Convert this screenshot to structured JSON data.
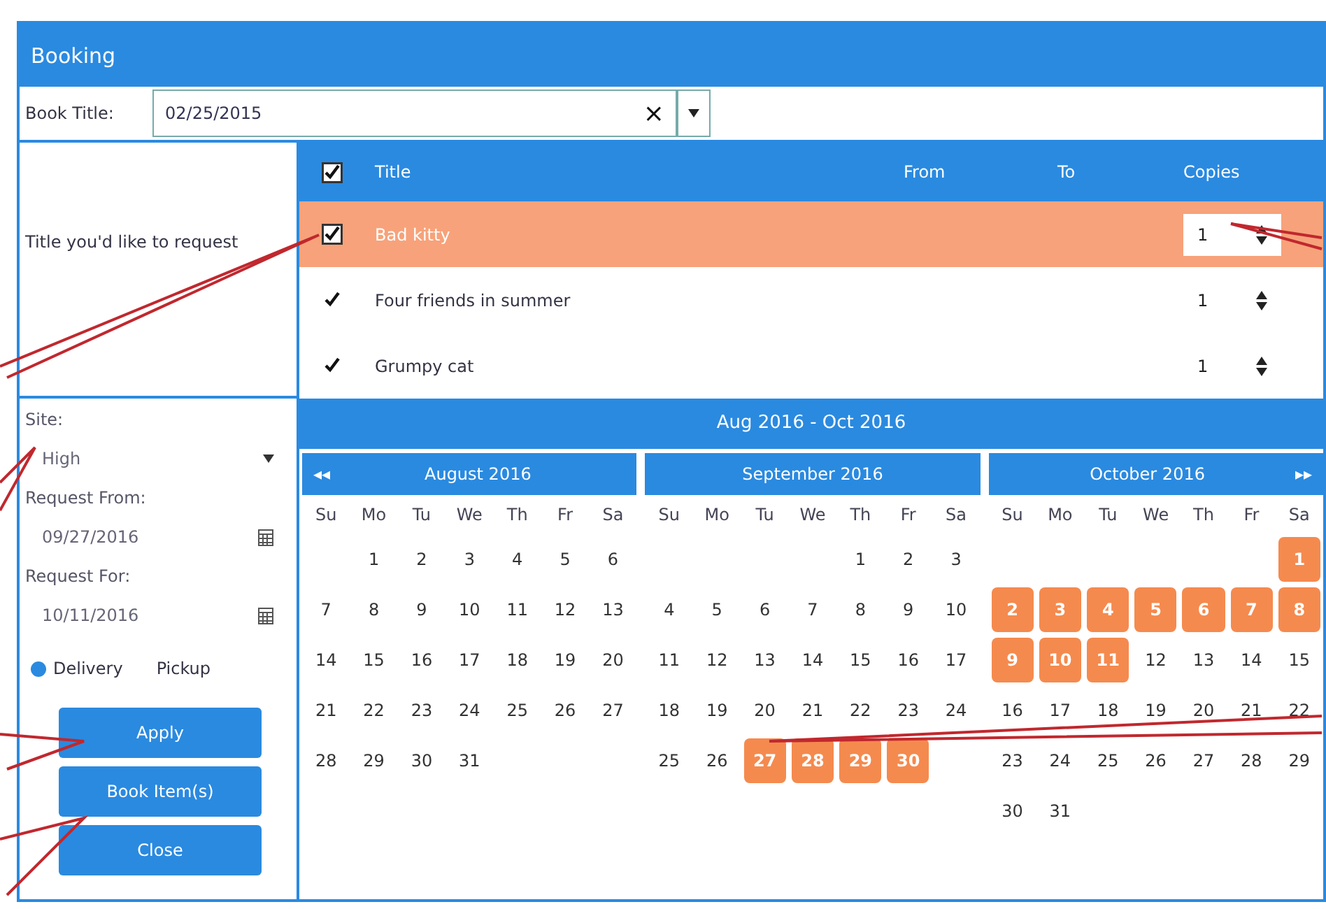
{
  "window": {
    "title": "Booking"
  },
  "book_title": {
    "label": "Book Title:",
    "value": "02/25/2015",
    "clear": "×"
  },
  "request_label": "Title you'd like to request",
  "table": {
    "columns": [
      "Title",
      "From",
      "To",
      "Copies"
    ],
    "all_checked": true,
    "rows": [
      {
        "title": "Bad kitty",
        "copies": "1",
        "checked": true,
        "selected": true
      },
      {
        "title": "Four friends in summer",
        "copies": "1",
        "checked": true,
        "selected": false
      },
      {
        "title": "Grumpy cat",
        "copies": "1",
        "checked": true,
        "selected": false
      }
    ]
  },
  "form": {
    "site_label": "Site:",
    "site_value": "High",
    "from_label": "Request From:",
    "from_value": "09/27/2016",
    "for_label": "Request For:",
    "for_value": "10/11/2016",
    "options": [
      {
        "label": "Delivery",
        "selected": true
      },
      {
        "label": "Pickup",
        "selected": false
      }
    ],
    "buttons": [
      "Apply",
      "Book Item(s)",
      "Close"
    ]
  },
  "calendar": {
    "range": "Aug 2016 - Oct 2016",
    "prev": "◂◂",
    "next": "▸▸",
    "months": [
      {
        "title": "August 2016",
        "weekdays": [
          "Su",
          "Mo",
          "Tu",
          "We",
          "Th",
          "Fr",
          "Sa"
        ],
        "weeks": [
          {
            "kind": "leading",
            "days": [
              {
                "label": "1",
                "booked": false
              },
              {
                "label": "2",
                "booked": false
              },
              {
                "label": "3",
                "booked": false
              },
              {
                "label": "4",
                "booked": false
              },
              {
                "label": "5",
                "booked": false
              },
              {
                "label": "6",
                "booked": false
              }
            ]
          },
          {
            "kind": "full",
            "days": [
              {
                "label": "7",
                "booked": false
              },
              {
                "label": "8",
                "booked": false
              },
              {
                "label": "9",
                "booked": false
              },
              {
                "label": "10",
                "booked": false
              },
              {
                "label": "11",
                "booked": false
              },
              {
                "label": "12",
                "booked": false
              },
              {
                "label": "13",
                "booked": false
              }
            ]
          },
          {
            "kind": "full",
            "days": [
              {
                "label": "14",
                "booked": false
              },
              {
                "label": "15",
                "booked": false
              },
              {
                "label": "16",
                "booked": false
              },
              {
                "label": "17",
                "booked": false
              },
              {
                "label": "18",
                "booked": false
              },
              {
                "label": "19",
                "booked": false
              },
              {
                "label": "20",
                "booked": false
              }
            ]
          },
          {
            "kind": "full",
            "days": [
              {
                "label": "21",
                "booked": false
              },
              {
                "label": "22",
                "booked": false
              },
              {
                "label": "23",
                "booked": false
              },
              {
                "label": "24",
                "booked": false
              },
              {
                "label": "25",
                "booked": false
              },
              {
                "label": "26",
                "booked": false
              },
              {
                "label": "27",
                "booked": false
              }
            ]
          },
          {
            "kind": "trailing",
            "days": [
              {
                "label": "28",
                "booked": false
              },
              {
                "label": "29",
                "booked": false
              },
              {
                "label": "30",
                "booked": false
              },
              {
                "label": "31",
                "booked": false
              }
            ]
          }
        ]
      },
      {
        "title": "September 2016",
        "weekdays": [
          "Su",
          "Mo",
          "Tu",
          "We",
          "Th",
          "Fr",
          "Sa"
        ],
        "weeks": [
          {
            "kind": "leading",
            "days": [
              {
                "label": "1",
                "booked": false
              },
              {
                "label": "2",
                "booked": false
              },
              {
                "label": "3",
                "booked": false
              }
            ]
          },
          {
            "kind": "full",
            "days": [
              {
                "label": "4",
                "booked": false
              },
              {
                "label": "5",
                "booked": false
              },
              {
                "label": "6",
                "booked": false
              },
              {
                "label": "7",
                "booked": false
              },
              {
                "label": "8",
                "booked": false
              },
              {
                "label": "9",
                "booked": false
              },
              {
                "label": "10",
                "booked": false
              }
            ]
          },
          {
            "kind": "full",
            "days": [
              {
                "label": "11",
                "booked": false
              },
              {
                "label": "12",
                "booked": false
              },
              {
                "label": "13",
                "booked": false
              },
              {
                "label": "14",
                "booked": false
              },
              {
                "label": "15",
                "booked": false
              },
              {
                "label": "16",
                "booked": false
              },
              {
                "label": "17",
                "booked": false
              }
            ]
          },
          {
            "kind": "full",
            "days": [
              {
                "label": "18",
                "booked": false
              },
              {
                "label": "19",
                "booked": false
              },
              {
                "label": "20",
                "booked": false
              },
              {
                "label": "21",
                "booked": false
              },
              {
                "label": "22",
                "booked": false
              },
              {
                "label": "23",
                "booked": false
              },
              {
                "label": "24",
                "booked": false
              }
            ]
          },
          {
            "kind": "trailing",
            "days": [
              {
                "label": "25",
                "booked": false
              },
              {
                "label": "26",
                "booked": false
              },
              {
                "label": "27",
                "booked": true
              },
              {
                "label": "28",
                "booked": true
              },
              {
                "label": "29",
                "booked": true
              },
              {
                "label": "30",
                "booked": true
              }
            ]
          }
        ]
      },
      {
        "title": "October 2016",
        "weekdays": [
          "Su",
          "Mo",
          "Tu",
          "We",
          "Th",
          "Fr",
          "Sa"
        ],
        "weeks": [
          {
            "kind": "leading",
            "days": [
              {
                "label": "1",
                "booked": true
              }
            ]
          },
          {
            "kind": "full",
            "days": [
              {
                "label": "2",
                "booked": true
              },
              {
                "label": "3",
                "booked": true
              },
              {
                "label": "4",
                "booked": true
              },
              {
                "label": "5",
                "booked": true
              },
              {
                "label": "6",
                "booked": true
              },
              {
                "label": "7",
                "booked": true
              },
              {
                "label": "8",
                "booked": true
              }
            ]
          },
          {
            "kind": "full",
            "days": [
              {
                "label": "9",
                "booked": true
              },
              {
                "label": "10",
                "booked": true
              },
              {
                "label": "11",
                "booked": true
              },
              {
                "label": "12",
                "booked": false
              },
              {
                "label": "13",
                "booked": false
              },
              {
                "label": "14",
                "booked": false
              },
              {
                "label": "15",
                "booked": false
              }
            ]
          },
          {
            "kind": "full",
            "days": [
              {
                "label": "16",
                "booked": false
              },
              {
                "label": "17",
                "booked": false
              },
              {
                "label": "18",
                "booked": false
              },
              {
                "label": "19",
                "booked": false
              },
              {
                "label": "20",
                "booked": false
              },
              {
                "label": "21",
                "booked": false
              },
              {
                "label": "22",
                "booked": false
              }
            ]
          },
          {
            "kind": "full",
            "days": [
              {
                "label": "23",
                "booked": false
              },
              {
                "label": "24",
                "booked": false
              },
              {
                "label": "25",
                "booked": false
              },
              {
                "label": "26",
                "booked": false
              },
              {
                "label": "27",
                "booked": false
              },
              {
                "label": "28",
                "booked": false
              },
              {
                "label": "29",
                "booked": false
              }
            ]
          },
          {
            "kind": "trailing",
            "days": [
              {
                "label": "30",
                "booked": false
              },
              {
                "label": "31",
                "booked": false
              }
            ]
          }
        ]
      }
    ]
  }
}
